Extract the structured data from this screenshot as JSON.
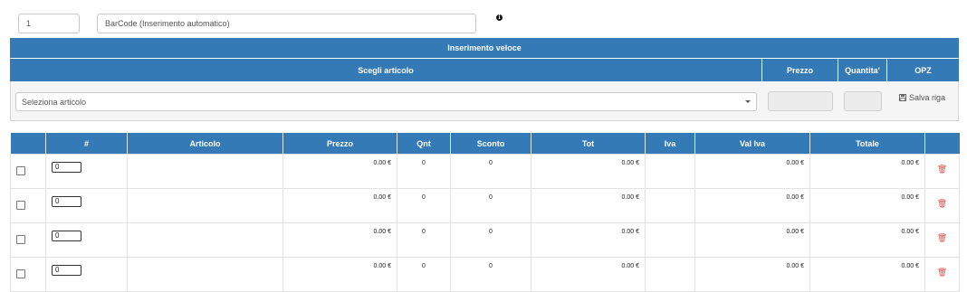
{
  "top": {
    "quantity_value": "1",
    "barcode_placeholder": "BarCode (Inserimento automatico)"
  },
  "quick_insert": {
    "title": "Inserimento veloce",
    "col_article": "Scegli articolo",
    "col_price": "Prezzo",
    "col_quantity": "Quantita'",
    "col_opz": "OPZ",
    "select_placeholder": "Seleziona articolo",
    "save_label": "Salva riga"
  },
  "table": {
    "headers": [
      "#",
      "Articolo",
      "Prezzo",
      "Qnt",
      "Sconto",
      "Tot",
      "Iva",
      "Val Iva",
      "Totale"
    ],
    "rows": [
      {
        "pos": "0",
        "article": "",
        "price": "0.00 €",
        "qnt": "0",
        "discount": "0",
        "tot": "0.00 €",
        "iva": "",
        "val_iva": "0.00 €",
        "total": "0.00 €"
      },
      {
        "pos": "0",
        "article": "",
        "price": "0.00 €",
        "qnt": "0",
        "discount": "0",
        "tot": "0.00 €",
        "iva": "",
        "val_iva": "0.00 €",
        "total": "0.00 €"
      },
      {
        "pos": "0",
        "article": "",
        "price": "0.00 €",
        "qnt": "0",
        "discount": "0",
        "tot": "0.00 €",
        "iva": "",
        "val_iva": "0.00 €",
        "total": "0.00 €"
      },
      {
        "pos": "0",
        "article": "",
        "price": "0.00 €",
        "qnt": "0",
        "discount": "0",
        "tot": "0.00 €",
        "iva": "",
        "val_iva": "0.00 €",
        "total": "0.00 €"
      }
    ]
  },
  "colors": {
    "header_blue": "#337ab7",
    "delete_red": "#d9534f"
  },
  "icons": {
    "info": "info-icon",
    "save": "floppy-disk-icon",
    "delete": "trash-icon",
    "dropdown": "caret-down-icon"
  }
}
